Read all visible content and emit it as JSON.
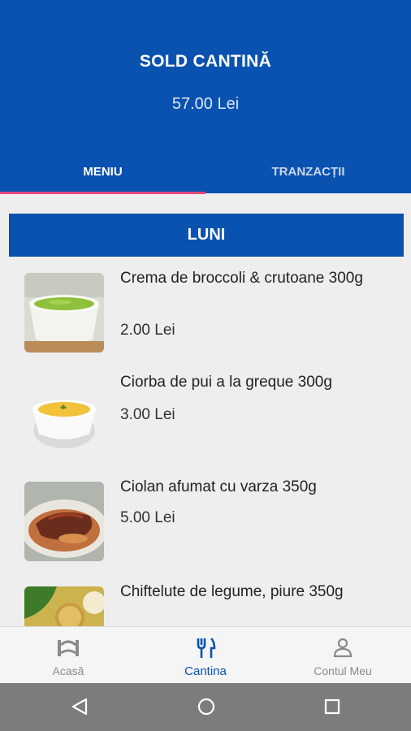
{
  "header": {
    "title": "SOLD CANTINĂ",
    "balance": "57.00 Lei",
    "tabs": [
      {
        "label": "MENIU",
        "active": true
      },
      {
        "label": "TRANZACȚII",
        "active": false
      }
    ]
  },
  "menu": {
    "day": "LUNI",
    "items": [
      {
        "name": "Crema de broccoli & crutoane 300g",
        "price": "2.00 Lei",
        "image": "broccoli-soup"
      },
      {
        "name": "Ciorba de pui a la greque 300g",
        "price": "3.00 Lei",
        "image": "chicken-soup"
      },
      {
        "name": "Ciolan afumat cu varza 350g",
        "price": "5.00 Lei",
        "image": "smoked-ham"
      },
      {
        "name": "Chiftelute de legume, piure 350g",
        "price": "",
        "image": "veggie-patties"
      }
    ]
  },
  "bottom_nav": {
    "items": [
      {
        "label": "Acasă",
        "icon": "home-gate-icon",
        "active": false
      },
      {
        "label": "Cantina",
        "icon": "fork-knife-icon",
        "active": true
      },
      {
        "label": "Contul Meu",
        "icon": "person-icon",
        "active": false
      }
    ]
  },
  "colors": {
    "primary": "#0a52b0",
    "tab_indicator": "#e5497a",
    "background": "#eeeeee"
  }
}
